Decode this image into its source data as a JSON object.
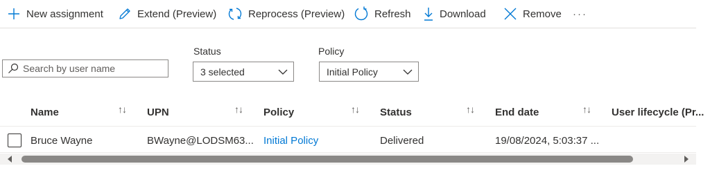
{
  "toolbar": {
    "new_assignment": "New assignment",
    "extend": "Extend (Preview)",
    "reprocess": "Reprocess (Preview)",
    "refresh": "Refresh",
    "download": "Download",
    "remove": "Remove",
    "more": "···"
  },
  "filters": {
    "search_placeholder": "Search by user name",
    "status_label": "Status",
    "status_value": "3 selected",
    "policy_label": "Policy",
    "policy_value": "Initial Policy"
  },
  "table": {
    "columns": [
      "Name",
      "UPN",
      "Policy",
      "Status",
      "End date",
      "User lifecycle (Pr..."
    ],
    "sort_glyph": "↑↓",
    "rows": [
      {
        "name": "Bruce Wayne",
        "upn": "BWayne@LODSM63...",
        "policy": "Initial Policy",
        "status": "Delivered",
        "end_date": "19/08/2024, 5:03:37 ..."
      }
    ]
  },
  "colors": {
    "accent": "#0078d4",
    "text": "#323130",
    "border": "#8a8886"
  }
}
